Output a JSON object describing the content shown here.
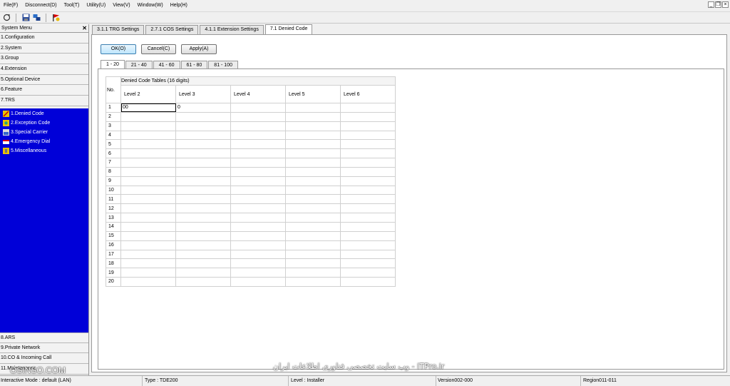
{
  "menu": [
    "File(F)",
    "Disconnect(D)",
    "Tool(T)",
    "Utility(U)",
    "View(V)",
    "Window(W)",
    "Help(H)"
  ],
  "toolbar": {
    "icons": [
      "refresh-icon",
      "save-icon",
      "network-icon",
      "flag-icon"
    ]
  },
  "sidebar": {
    "title": "System Menu",
    "close": "✕",
    "items_top": [
      "1.Configuration",
      "2.System",
      "3.Group",
      "4.Extension",
      "5.Optional Device",
      "6.Feature",
      "7.TRS"
    ],
    "sub_items": [
      "1.Denied Code",
      "2.Exception Code",
      "3.Special Carrier",
      "4.Emergency Dial",
      "5.Miscellaneous"
    ],
    "items_bottom": [
      "8.ARS",
      "9.Private Network",
      "10.CO & Incoming Call",
      "11.Maintenance"
    ]
  },
  "doc_tabs": [
    "3.1.1 TRG Settings",
    "2.7.1 COS Settings",
    "4.1.1 Extension Settings",
    "7.1 Denied Code"
  ],
  "buttons": {
    "ok": "OK(O)",
    "cancel": "Cancel(C)",
    "apply": "Apply(A)"
  },
  "page_tabs": [
    "1 - 20",
    "21 - 40",
    "41 - 60",
    "61 - 80",
    "81 - 100"
  ],
  "table": {
    "no_header": "No.",
    "group_header": "Denied Code Tables (16 digits)",
    "levels": [
      "Level 2",
      "Level 3",
      "Level 4",
      "Level 5",
      "Level 6"
    ],
    "rows": [
      {
        "no": "1",
        "cells": [
          "00",
          "0",
          "",
          "",
          ""
        ]
      },
      {
        "no": "2",
        "cells": [
          "",
          "",
          "",
          "",
          ""
        ]
      },
      {
        "no": "3",
        "cells": [
          "",
          "",
          "",
          "",
          ""
        ]
      },
      {
        "no": "4",
        "cells": [
          "",
          "",
          "",
          "",
          ""
        ]
      },
      {
        "no": "5",
        "cells": [
          "",
          "",
          "",
          "",
          ""
        ]
      },
      {
        "no": "6",
        "cells": [
          "",
          "",
          "",
          "",
          ""
        ]
      },
      {
        "no": "7",
        "cells": [
          "",
          "",
          "",
          "",
          ""
        ]
      },
      {
        "no": "8",
        "cells": [
          "",
          "",
          "",
          "",
          ""
        ]
      },
      {
        "no": "9",
        "cells": [
          "",
          "",
          "",
          "",
          ""
        ]
      },
      {
        "no": "10",
        "cells": [
          "",
          "",
          "",
          "",
          ""
        ]
      },
      {
        "no": "11",
        "cells": [
          "",
          "",
          "",
          "",
          ""
        ]
      },
      {
        "no": "12",
        "cells": [
          "",
          "",
          "",
          "",
          ""
        ]
      },
      {
        "no": "13",
        "cells": [
          "",
          "",
          "",
          "",
          ""
        ]
      },
      {
        "no": "14",
        "cells": [
          "",
          "",
          "",
          "",
          ""
        ]
      },
      {
        "no": "15",
        "cells": [
          "",
          "",
          "",
          "",
          ""
        ]
      },
      {
        "no": "16",
        "cells": [
          "",
          "",
          "",
          "",
          ""
        ]
      },
      {
        "no": "17",
        "cells": [
          "",
          "",
          "",
          "",
          ""
        ]
      },
      {
        "no": "18",
        "cells": [
          "",
          "",
          "",
          "",
          ""
        ]
      },
      {
        "no": "19",
        "cells": [
          "",
          "",
          "",
          "",
          ""
        ]
      },
      {
        "no": "20",
        "cells": [
          "",
          "",
          "",
          "",
          ""
        ]
      }
    ]
  },
  "status": {
    "mode": "Interactive Mode : default (LAN)",
    "type": "Type : TDE200",
    "level": "Level : Installer",
    "version": "Version002-000",
    "region": "Region011-011"
  },
  "watermark": {
    "site": "وب سایت تخصصی فناوری اطلاعات ایران - ITPro.ir",
    "brand": "OSINSO.COM"
  },
  "colors": {
    "sidebar_sub_bg": "#0000d8",
    "primary_btn": "#bee6fd"
  }
}
